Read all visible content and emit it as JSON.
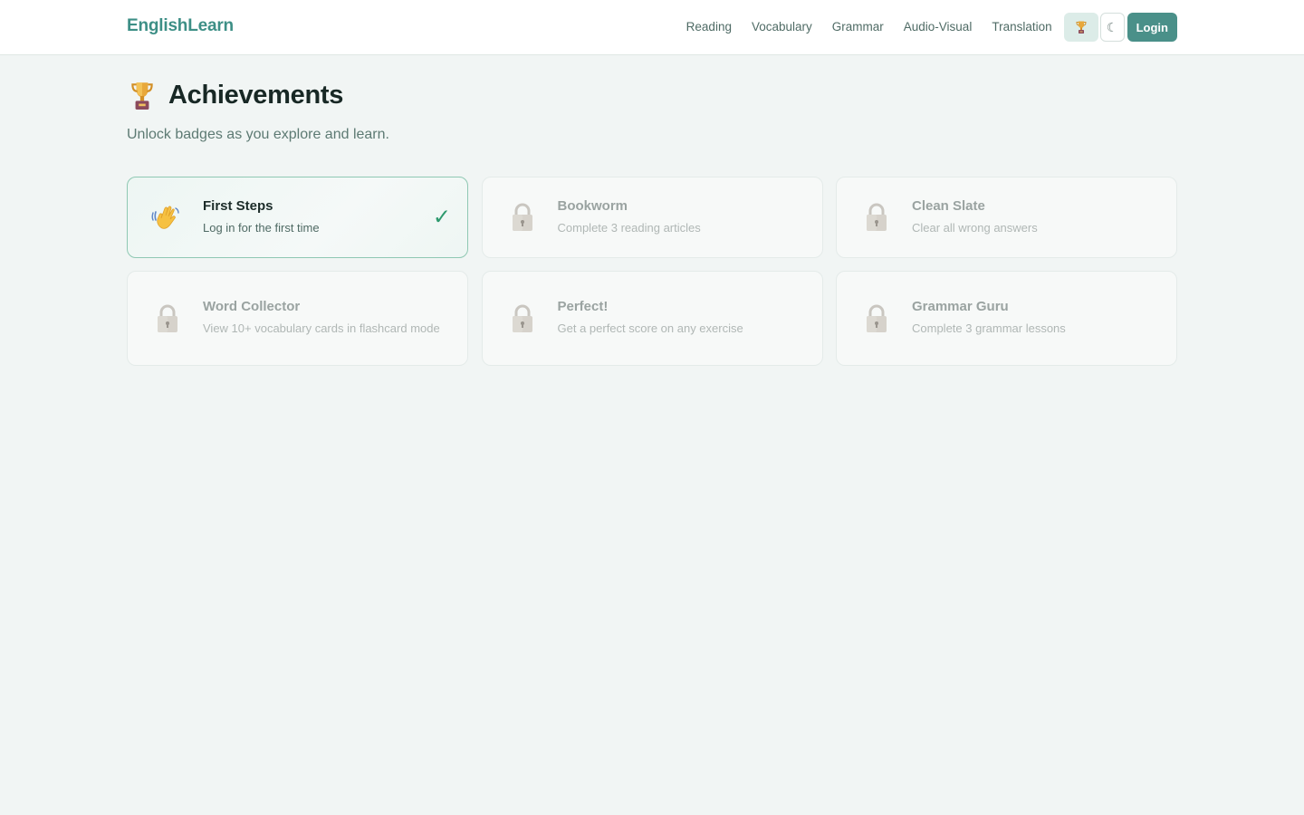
{
  "nav": {
    "brand": "EnglishLearn",
    "links": [
      "Reading",
      "Vocabulary",
      "Grammar",
      "Audio-Visual",
      "Translation"
    ],
    "trophy_icon": "trophy-icon",
    "theme_icon": "moon-icon",
    "theme_glyph": "☾",
    "login_label": "Login"
  },
  "page": {
    "title": "Achievements",
    "subtitle": "Unlock badges as you explore and learn."
  },
  "achievements": [
    {
      "title": "First Steps",
      "description": "Log in for the first time",
      "unlocked": true,
      "icon": "waving-hand-icon",
      "check": "✓"
    },
    {
      "title": "Bookworm",
      "description": "Complete 3 reading articles",
      "unlocked": false,
      "icon": "lock-icon"
    },
    {
      "title": "Clean Slate",
      "description": "Clear all wrong answers",
      "unlocked": false,
      "icon": "lock-icon"
    },
    {
      "title": "Word Collector",
      "description": "View 10+ vocabulary cards in flashcard mode",
      "unlocked": false,
      "icon": "lock-icon"
    },
    {
      "title": "Perfect!",
      "description": "Get a perfect score on any exercise",
      "unlocked": false,
      "icon": "lock-icon"
    },
    {
      "title": "Grammar Guru",
      "description": "Complete 3 grammar lessons",
      "unlocked": false,
      "icon": "lock-icon"
    }
  ],
  "colors": {
    "accent": "#4a9089",
    "brand": "#3d8f86",
    "unlocked_border": "#8fc8b3",
    "check": "#2e9a6e"
  }
}
